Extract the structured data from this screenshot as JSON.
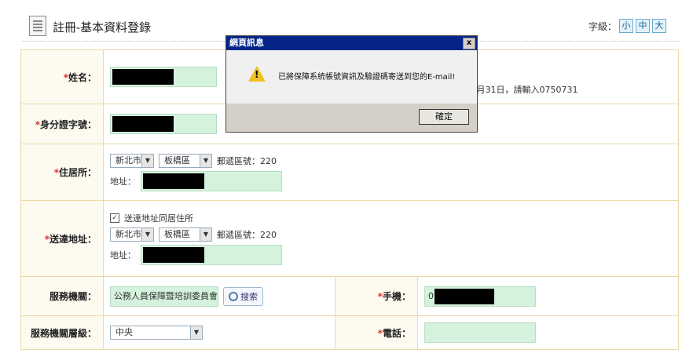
{
  "header": {
    "title": "註冊-基本資料登錄",
    "font_size_label": "字級：",
    "font_sizes": [
      "小",
      "中",
      "大"
    ]
  },
  "form": {
    "name_label": "姓名：",
    "name_hint": "月31日，請輸入0750731",
    "id_label": "身分證字號：",
    "residence_label": "住居所：",
    "city_value": "新北市",
    "district_value": "板橋區",
    "postal_label": "郵遞區號：220",
    "address_label": "地址：",
    "mailing_label": "送達地址：",
    "same_as_residence": "送達地址同居住所",
    "agency_label": "服務機關：",
    "agency_value": "公務人員保障暨培訓委員會",
    "search_label": "搜索",
    "mobile_label": "手機：",
    "mobile_prefix": "0",
    "agency_level_label": "服務機關層級：",
    "agency_level_value": "中央",
    "phone_label": "電話："
  },
  "dialog": {
    "title": "網頁訊息",
    "close": "x",
    "message": "已將保障系統帳號資訊及驗證碼寄送到您的E-mail!",
    "ok_label": "確定"
  }
}
